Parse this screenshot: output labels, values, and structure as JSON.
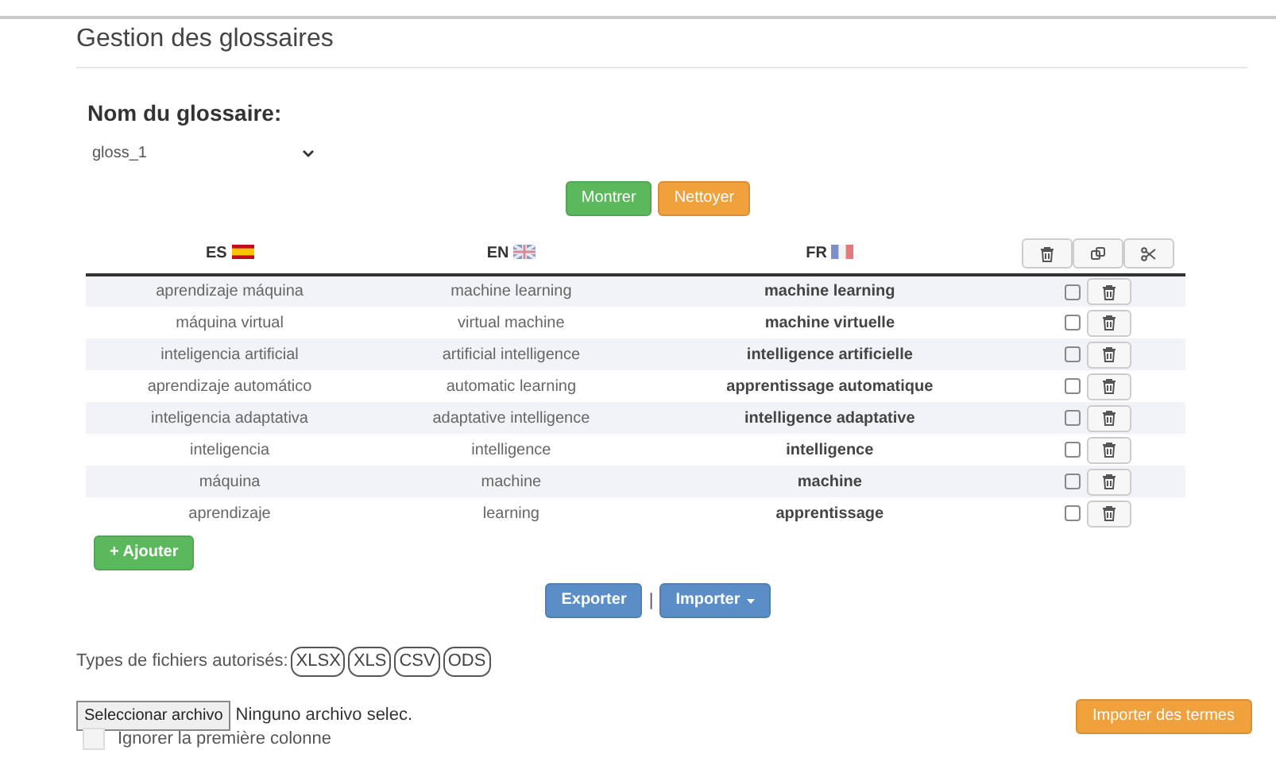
{
  "page_title": "Gestion des glossaires",
  "glossary": {
    "label": "Nom du glossaire:",
    "value": "gloss_1"
  },
  "top_buttons": [
    {
      "label": "Montrer",
      "kind": "success"
    },
    {
      "label": "Nettoyer",
      "kind": "warning"
    }
  ],
  "table": {
    "columns": [
      {
        "label": "ES"
      },
      {
        "label": "EN"
      },
      {
        "label": "FR"
      }
    ],
    "rows": [
      {
        "es": "aprendizaje máquina",
        "en": "machine learning",
        "fr": "machine learning",
        "checked": false
      },
      {
        "es": "máquina virtual",
        "en": "virtual machine",
        "fr": "machine virtuelle",
        "checked": false
      },
      {
        "es": "inteligencia artificial",
        "en": "artificial intelligence",
        "fr": "intelligence artificielle",
        "checked": false
      },
      {
        "es": "aprendizaje automático",
        "en": "automatic learning",
        "fr": "apprentissage automatique",
        "checked": false
      },
      {
        "es": "inteligencia adaptativa",
        "en": "adaptative intelligence",
        "fr": "intelligence adaptative",
        "checked": false
      },
      {
        "es": "inteligencia",
        "en": "intelligence",
        "fr": "intelligence",
        "checked": false
      },
      {
        "es": "máquina",
        "en": "machine",
        "fr": "machine",
        "checked": false
      },
      {
        "es": "aprendizaje",
        "en": "learning",
        "fr": "apprentissage",
        "checked": false
      }
    ]
  },
  "add_button": "+ Ajouter",
  "export_button": "Exporter",
  "separator": "|",
  "import_button": "Importer",
  "file_types": {
    "label": "Types de fichiers autorisés:",
    "types": [
      "XLSX",
      "XLS",
      "CSV",
      "ODS"
    ]
  },
  "file_input": {
    "button": "Seleccionar archivo",
    "status": "Ninguno archivo selec."
  },
  "import_terms_button": "Importer des termes",
  "ignore_first_column": {
    "label": "Ignorer la première colonne",
    "checked": false
  }
}
